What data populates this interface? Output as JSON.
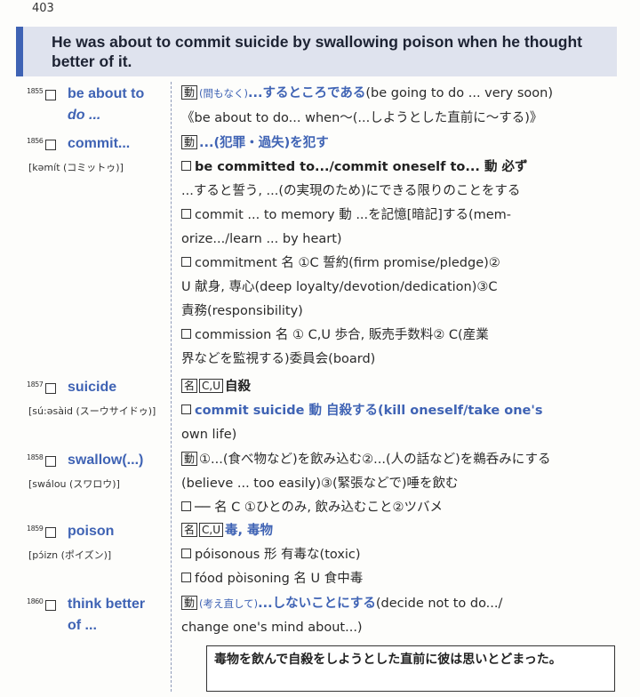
{
  "page_number": "403",
  "headline": "He was about to commit suicide by swallowing poison when he thought better of it.",
  "entries": [
    {
      "num": "1855",
      "word_line1": "be about to",
      "word_line2": "do ...",
      "pron": "",
      "lines": [
        {
          "tag": "動",
          "paren": "(間もなく)",
          "text": "...するところである",
          "rest": "(be going to do ... very soon)"
        },
        {
          "text": "《be about to do... when〜(...しようとした直前に〜する)》"
        }
      ]
    },
    {
      "num": "1856",
      "word_line1": "commit...",
      "pron": "[kəmít (コミットゥ)]",
      "lines": [
        {
          "tag": "動",
          "text": "...(犯罪・過失)を犯す"
        },
        {
          "text": "be committed to.../commit oneself to... 動 必ず"
        },
        {
          "text": "...すると誓う, ...(の実現のため)にできる限りのことをする"
        },
        {
          "text": "commit ... to memory 動 ...を記憶[暗記]する(mem-"
        },
        {
          "text": "orize.../learn ... by heart)"
        },
        {
          "text": "commitment 名 ①C 誓約(firm promise/pledge)②"
        },
        {
          "text": "U 献身, 専心(deep loyalty/devotion/dedication)③C"
        },
        {
          "text": "責務(responsibility)"
        },
        {
          "text": "commission 名 ① C,U 歩合, 販売手数料② C(産業"
        },
        {
          "text": "界などを監視する)委員会(board)"
        }
      ]
    },
    {
      "num": "1857",
      "word_line1": "suicide",
      "pron": "[sú:əsàid (スーウサイドゥ)]",
      "lines": [
        {
          "tag": "名",
          "tag2": "C,U",
          "text": "自殺"
        },
        {
          "text": "commit suicide 動 自殺する(kill oneself/take one's"
        },
        {
          "text": "own life)"
        }
      ]
    },
    {
      "num": "1858",
      "word_line1": "swallow(...)",
      "pron": "[swálou (スワロウ)]",
      "lines": [
        {
          "tag": "動",
          "text": "①...(食べ物など)を飲み込む②...(人の話など)を鵜呑みにする"
        },
        {
          "text": "(believe ... too easily)③(緊張などで)唾を飲む"
        },
        {
          "text": "── 名 C ①ひとのみ, 飲み込むこと②ツバメ"
        }
      ]
    },
    {
      "num": "1859",
      "word_line1": "poison",
      "pron": "[pɔ́izn (ポイズン)]",
      "lines": [
        {
          "tag": "名",
          "tag2": "C,U",
          "text": "毒, 毒物"
        },
        {
          "text": "póisonous 形 有毒な(toxic)"
        },
        {
          "text": "fóod pòisoning 名 U 食中毒"
        }
      ]
    },
    {
      "num": "1860",
      "word_line1": "think better",
      "word_line2": "of ...",
      "pron": "",
      "lines": [
        {
          "tag": "動",
          "paren": "(考え直して)",
          "text": "...しないことにする",
          "rest": "(decide not to do.../"
        },
        {
          "text": "change one's mind about...)"
        }
      ]
    }
  ],
  "answer": "毒物を飲んで自殺をしようとした直前に彼は思いとどまった。",
  "colors": {
    "accent": "#3f63b4",
    "headline_bg": "#dfe3ee"
  }
}
